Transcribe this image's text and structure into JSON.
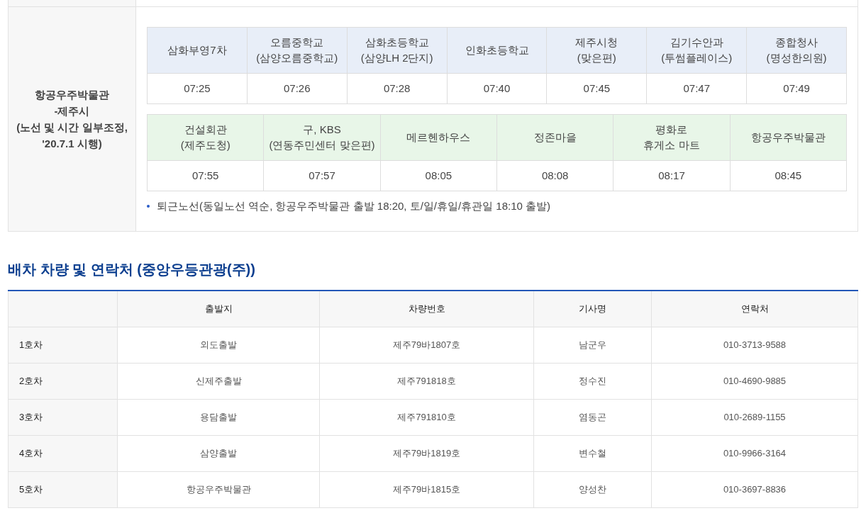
{
  "route": {
    "label": "항공우주박물관\n-제주시\n(노선 및 시간 일부조정,\n'20.7.1 시행)",
    "stop_tables": [
      {
        "color": "#e8eef8",
        "stops": [
          {
            "name": "삼화부영7차",
            "time": "07:25"
          },
          {
            "name": "오름중학교\n(삼양오름중학교)",
            "time": "07:26"
          },
          {
            "name": "삼화초등학교\n(삼양LH 2단지)",
            "time": "07:28"
          },
          {
            "name": "인화초등학교",
            "time": "07:40"
          },
          {
            "name": "제주시청\n(맞은편)",
            "time": "07:45"
          },
          {
            "name": "김기수안과\n(투썸플레이스)",
            "time": "07:47"
          },
          {
            "name": "종합청사\n(명성한의원)",
            "time": "07:49"
          }
        ]
      },
      {
        "color": "#e8f6e8",
        "stops": [
          {
            "name": "건설회관\n(제주도청)",
            "time": "07:55"
          },
          {
            "name": "구, KBS\n(연동주민센터 맞은편)",
            "time": "07:57"
          },
          {
            "name": "메르헨하우스",
            "time": "08:05"
          },
          {
            "name": "정존마을",
            "time": "08:08"
          },
          {
            "name": "평화로\n휴게소 마트",
            "time": "08:17"
          },
          {
            "name": "항공우주박물관",
            "time": "08:45"
          }
        ]
      }
    ],
    "note": "퇴근노선(동일노선 역순, 항공우주박물관 출발 18:20, 토/일/휴일/휴관일 18:10 출발)"
  },
  "section_title": "배차 차량 및 연락처 (중앙우등관광(주))",
  "table": {
    "columns": [
      "출발지",
      "차량번호",
      "기사명",
      "연락처"
    ],
    "rows": [
      {
        "label": "1호차",
        "cells": [
          "외도출발",
          "제주79바1807호",
          "남군우",
          "010-3713-9588"
        ]
      },
      {
        "label": "2호차",
        "cells": [
          "신제주출발",
          "제주791818호",
          "정수진",
          "010-4690-9885"
        ]
      },
      {
        "label": "3호차",
        "cells": [
          "용담출발",
          "제주791810호",
          "염동곤",
          "010-2689-1155"
        ]
      },
      {
        "label": "4호차",
        "cells": [
          "삼양출발",
          "제주79바1819호",
          "변수철",
          "010-9966-3164"
        ]
      },
      {
        "label": "5호차",
        "cells": [
          "항공우주박물관",
          "제주79바1815호",
          "양성찬",
          "010-3697-8836"
        ]
      }
    ]
  }
}
